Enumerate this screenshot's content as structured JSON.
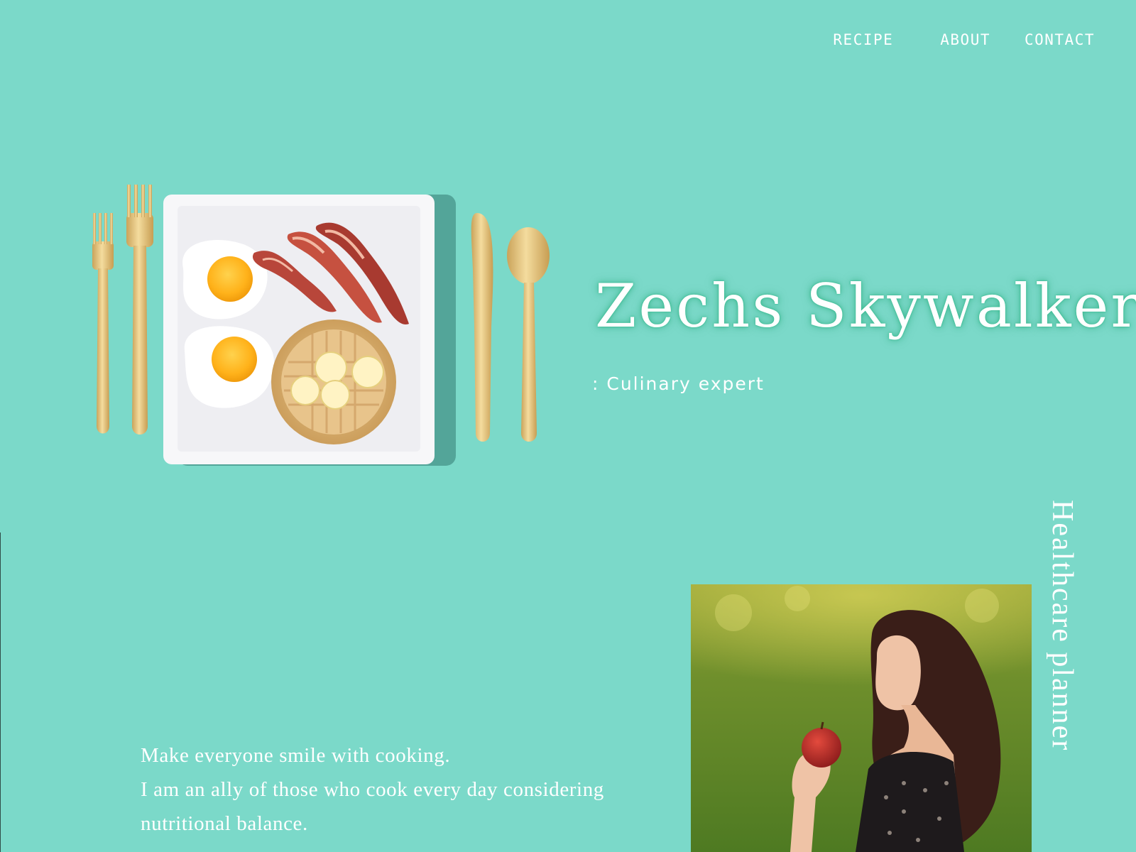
{
  "nav": {
    "items": [
      "RECIPE",
      "ABOUT",
      "CONTACT"
    ]
  },
  "hero": {
    "title": "Zechs Skywalker",
    "subtitle": ": Culinary expert"
  },
  "side": {
    "vertical_label": "Healthcare planner"
  },
  "intro": {
    "lines": [
      "Make everyone smile with cooking.",
      "I am an ally of those who cook every day considering",
      "nutritional balance."
    ]
  },
  "colors": {
    "background": "#7bd9c9",
    "text": "#ffffff",
    "title_glow": "#2fb98f",
    "cutlery_gold": "#e3c27a"
  },
  "images": {
    "hero": "breakfast-plate-with-gold-cutlery",
    "portrait": "woman-holding-red-apple-in-grass"
  }
}
